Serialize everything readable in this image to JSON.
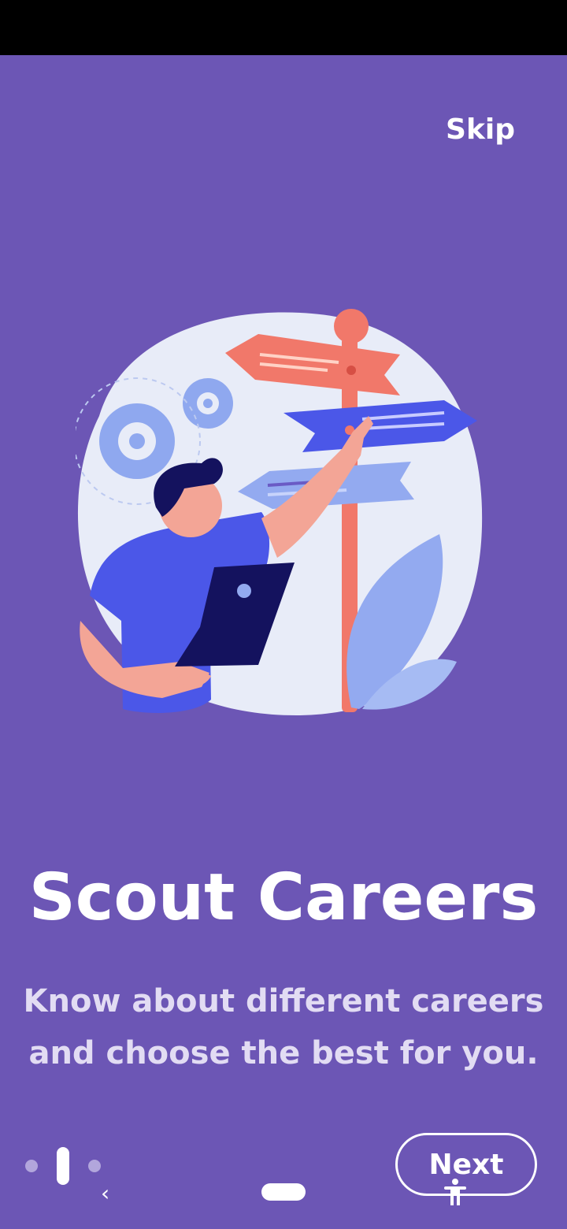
{
  "skip_label": "Skip",
  "title": "Scout Careers",
  "subtitle_line1": "Know about different careers",
  "subtitle_line2": "and choose the best for you.",
  "next_label": "Next",
  "pager": {
    "count": 3,
    "active_index": 1
  },
  "colors": {
    "background": "#6c56b5",
    "text": "#ffffff",
    "subtitle": "#e2dcf3",
    "dot_inactive": "#b2a6dc"
  },
  "icons": {
    "illustration": "career-signpost-illustration",
    "back": "back-chevron-icon",
    "home": "home-pill-icon",
    "accessibility": "accessibility-icon"
  }
}
